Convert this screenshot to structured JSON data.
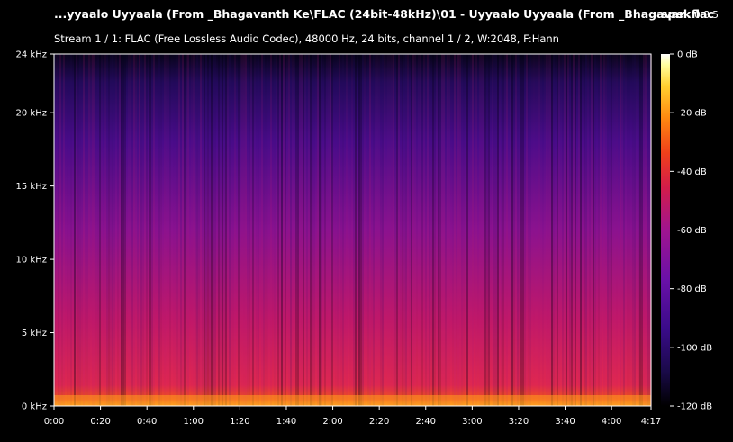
{
  "header": {
    "title": "...yyaalo Uyyaala (From _Bhagavanth Ke\\FLAC (24bit-48kHz)\\01 - Uyyaalo Uyyaala (From _Bhagavan.flac",
    "app_name": "spek",
    "app_version": "0.8.5",
    "stream_info": "Stream 1 / 1: FLAC (Free Lossless Audio Codec), 48000 Hz, 24 bits, channel 1 / 2, W:2048, F:Hann"
  },
  "chart_data": {
    "type": "heatmap",
    "x_ticks": [
      "0:00",
      "0:20",
      "0:40",
      "1:00",
      "1:20",
      "1:40",
      "2:00",
      "2:20",
      "2:40",
      "3:00",
      "3:20",
      "3:40",
      "4:00",
      "4:17"
    ],
    "x_tick_seconds": [
      0,
      20,
      40,
      60,
      80,
      100,
      120,
      140,
      160,
      180,
      200,
      220,
      240,
      257
    ],
    "xlim": [
      0,
      257
    ],
    "y_ticks": [
      "0 kHz",
      "5 kHz",
      "10 kHz",
      "15 kHz",
      "20 kHz",
      "24 kHz"
    ],
    "y_tick_khz": [
      0,
      5,
      10,
      15,
      20,
      24
    ],
    "ylim": [
      0,
      24
    ],
    "colorbar_ticks": [
      "0 dB",
      "-20 dB",
      "-40 dB",
      "-60 dB",
      "-80 dB",
      "-100 dB",
      "-120 dB"
    ],
    "colorbar_db": [
      0,
      -20,
      -40,
      -60,
      -80,
      -100,
      -120
    ],
    "colorbar_range": [
      -120,
      0
    ],
    "colormap": [
      "#000000",
      "#1a0a4a",
      "#3a0b8a",
      "#6a10a8",
      "#a0148f",
      "#d21c4a",
      "#f0401a",
      "#ff8a10",
      "#ffd030",
      "#ffffa0",
      "#ffffff"
    ]
  }
}
